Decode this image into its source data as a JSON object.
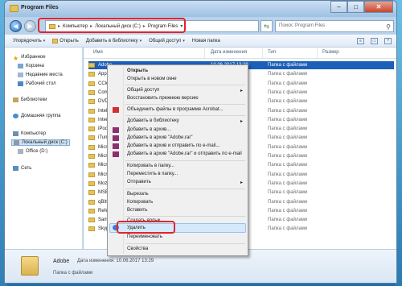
{
  "window": {
    "title": "Program Files"
  },
  "address": {
    "segments": [
      "Компьютер",
      "Локальный диск (C:)",
      "Program Files"
    ],
    "search_placeholder": "Поиск: Program Files"
  },
  "toolbar": {
    "organize": "Упорядочить",
    "open": "Открыть",
    "add_to_library": "Добавить в библиотеку",
    "share": "Общий доступ",
    "new_folder": "Новая папка"
  },
  "nav": {
    "favorites": "Избранное",
    "basket": "Корзина",
    "recent": "Недавние места",
    "desktop": "Рабочий стол",
    "libraries": "Библиотеки",
    "homegroup": "Домашняя группа",
    "computer": "Компьютер",
    "local_disk": "Локальный диск (C:)",
    "office_disk": "Office (D:)",
    "network": "Сеть"
  },
  "columns": {
    "name": "Имя",
    "date": "Дата изменения",
    "type": "Тип",
    "size": "Размер"
  },
  "files": [
    {
      "name": "Adobe",
      "date": "10.06.2017 13:29",
      "type": "Папка с файлами"
    },
    {
      "name": "Apple",
      "date": "",
      "type": "Папка с файлами"
    },
    {
      "name": "CClea",
      "date": "",
      "type": "Папка с файлами"
    },
    {
      "name": "Comm",
      "date": "",
      "type": "Папка с файлами"
    },
    {
      "name": "DVD M",
      "date": "",
      "type": "Папка с файлами"
    },
    {
      "name": "Intel",
      "date": "",
      "type": "Папка с файлами"
    },
    {
      "name": "Inter",
      "date": "",
      "type": "Папка с файлами"
    },
    {
      "name": "iPod",
      "date": "",
      "type": "Папка с файлами"
    },
    {
      "name": "iTune",
      "date": "",
      "type": "Папка с файлами"
    },
    {
      "name": "Micro",
      "date": "",
      "type": "Папка с файлами"
    },
    {
      "name": "Micro",
      "date": "",
      "type": "Папка с файлами"
    },
    {
      "name": "Micro",
      "date": "",
      "type": "Папка с файлами"
    },
    {
      "name": "Micro",
      "date": "",
      "type": "Папка с файлами"
    },
    {
      "name": "Mozil",
      "date": "",
      "type": "Папка с файлами"
    },
    {
      "name": "MSBu",
      "date": "",
      "type": "Папка с файлами"
    },
    {
      "name": "qBitt",
      "date": "",
      "type": "Папка с файлами"
    },
    {
      "name": "Refe",
      "date": "",
      "type": "Папка с файлами"
    },
    {
      "name": "Sams",
      "date": "",
      "type": "Папка с файлами"
    },
    {
      "name": "Skyp",
      "date": "",
      "type": "Папка с файлами"
    }
  ],
  "context_menu": {
    "open": "Открыть",
    "open_new_window": "Открыть в новом окне",
    "share": "Общий доступ",
    "restore": "Восстановить прежнюю версию",
    "acrobat": "Объединить файлы в программе Acrobat...",
    "add_library": "Добавить в библиотеку",
    "add_archive": "Добавить в архив...",
    "add_rar": "Добавить в архив \"Adobe.rar\"",
    "archive_email": "Добавить в архив и отправить по e-mail...",
    "rar_email": "Добавить в архив \"Adobe.rar\" и отправить по e-mail",
    "copy_to": "Копировать в папку...",
    "move_to": "Переместить в папку...",
    "send_to": "Отправить",
    "cut": "Вырезать",
    "copy": "Копировать",
    "paste": "Вставить",
    "shortcut": "Создать ярлык",
    "delete": "Удалить",
    "rename": "Переименовать",
    "properties": "Свойства"
  },
  "details": {
    "name": "Adobe",
    "date_label": "Дата изменения: 10.06.2017 13:29",
    "type": "Папка с файлами"
  },
  "colors": {
    "selection": "#1c5fb8",
    "highlight_box": "#e1242b",
    "folder": "#e6c25a"
  }
}
